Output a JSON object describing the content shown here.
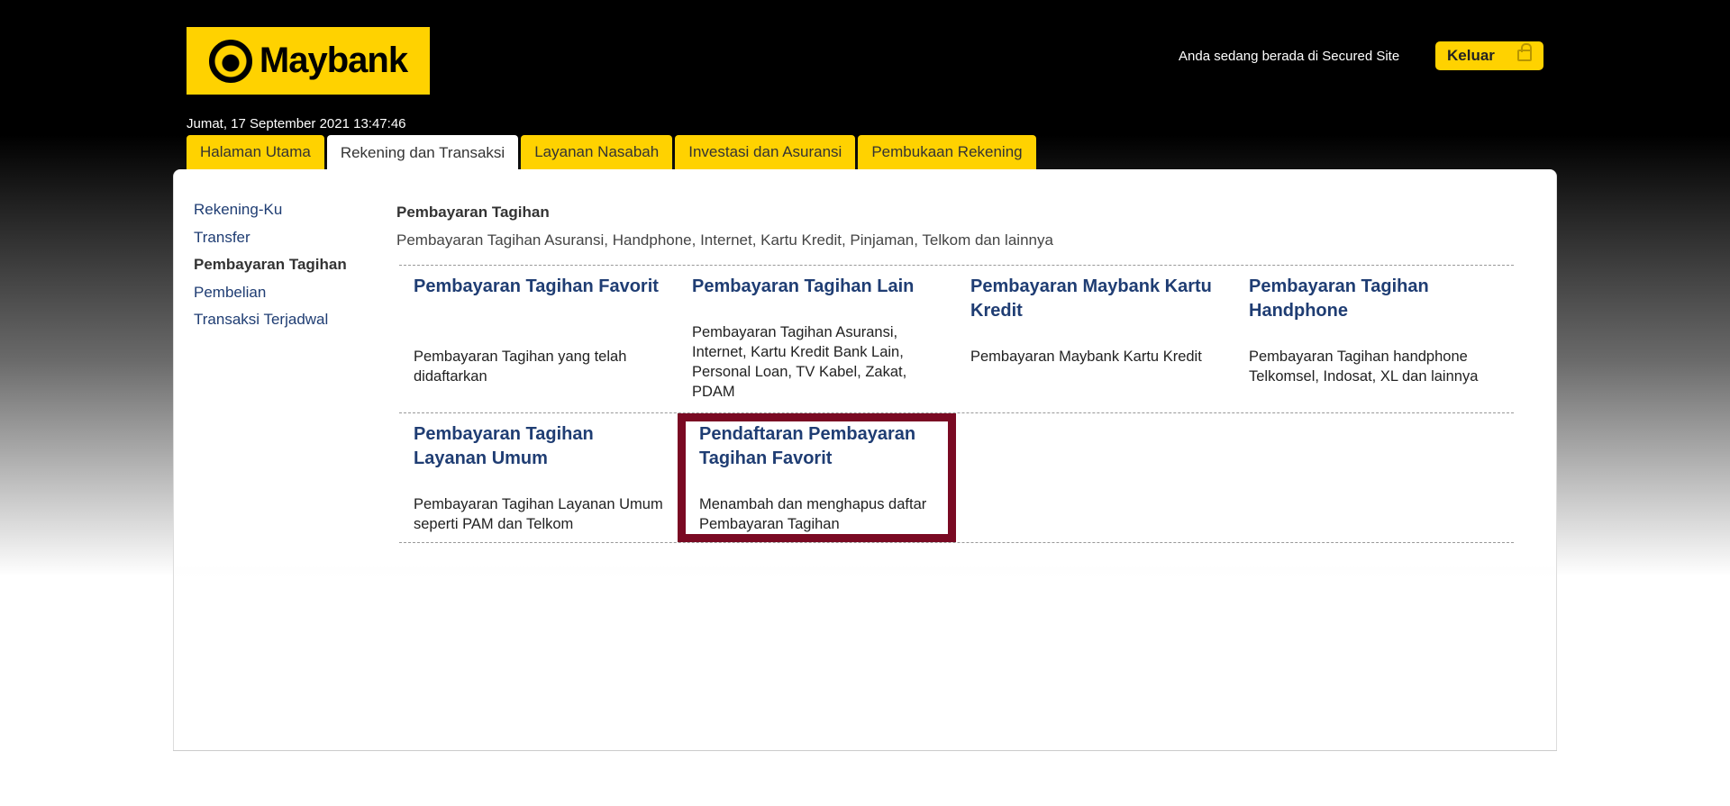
{
  "header": {
    "logo_text": "Maybank",
    "secured_text": "Anda sedang berada di Secured Site",
    "logout_label": "Keluar",
    "datetime": "Jumat, 17 September 2021 13:47:46"
  },
  "tabs": [
    {
      "label": "Halaman Utama"
    },
    {
      "label": "Rekening dan Transaksi",
      "active": true
    },
    {
      "label": "Layanan Nasabah"
    },
    {
      "label": "Investasi dan Asuransi"
    },
    {
      "label": "Pembukaan Rekening"
    }
  ],
  "sidebar": {
    "items": [
      {
        "label": "Rekening-Ku"
      },
      {
        "label": "Transfer"
      },
      {
        "label": "Pembayaran Tagihan",
        "active": true
      },
      {
        "label": "Pembelian"
      },
      {
        "label": "Transaksi Terjadwal"
      }
    ]
  },
  "main": {
    "title": "Pembayaran Tagihan",
    "description": "Pembayaran Tagihan Asuransi, Handphone, Internet, Kartu Kredit, Pinjaman, Telkom dan lainnya",
    "options": [
      {
        "title": "Pembayaran Tagihan Favorit",
        "desc": "Pembayaran Tagihan yang telah didaftarkan"
      },
      {
        "title": "Pembayaran Tagihan Lain",
        "desc": "Pembayaran Tagihan Asuransi, Internet, Kartu Kredit Bank Lain, Personal Loan, TV Kabel, Zakat, PDAM"
      },
      {
        "title": "Pembayaran Maybank Kartu Kredit",
        "desc": "Pembayaran Maybank Kartu Kredit"
      },
      {
        "title": "Pembayaran Tagihan Handphone",
        "desc": "Pembayaran Tagihan handphone Telkomsel, Indosat, XL dan lainnya"
      },
      {
        "title": "Pembayaran Tagihan Layanan Umum",
        "desc": "Pembayaran Tagihan Layanan Umum seperti PAM dan Telkom"
      },
      {
        "title": "Pendaftaran Pembayaran Tagihan Favorit",
        "desc": "Menambah dan menghapus daftar Pembayaran Tagihan"
      }
    ]
  },
  "colors": {
    "brand_yellow": "#ffd200",
    "link_blue": "#1f3d73",
    "highlight_border": "#7a0a23"
  }
}
